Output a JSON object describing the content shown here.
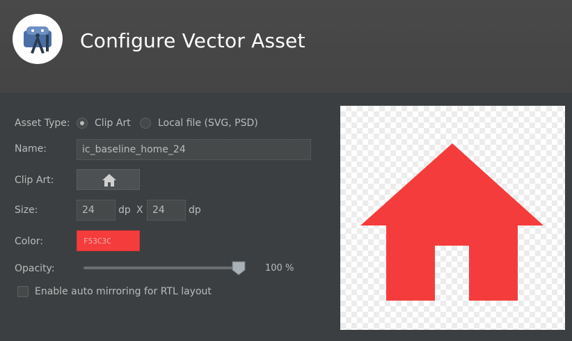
{
  "header": {
    "title": "Configure Vector Asset",
    "logo_icon": "android-studio-logo"
  },
  "form": {
    "asset_type": {
      "label": "Asset Type:",
      "options": [
        {
          "label": "Clip Art",
          "selected": true
        },
        {
          "label": "Local file (SVG, PSD)",
          "selected": false
        }
      ]
    },
    "name": {
      "label": "Name:",
      "value": "ic_baseline_home_24"
    },
    "clip_art": {
      "label": "Clip Art:",
      "icon": "home-icon"
    },
    "size": {
      "label": "Size:",
      "width": "24",
      "width_unit": "dp",
      "separator": "X",
      "height": "24",
      "height_unit": "dp"
    },
    "color": {
      "label": "Color:",
      "value": "F53C3C",
      "hex": "#F53C3C"
    },
    "opacity": {
      "label": "Opacity:",
      "value_text": "100 %",
      "level": 1.0
    },
    "auto_mirror": {
      "label": "Enable auto mirroring for RTL layout",
      "checked": false
    }
  },
  "preview": {
    "icon": "home-icon",
    "color": "#F53C3C"
  }
}
